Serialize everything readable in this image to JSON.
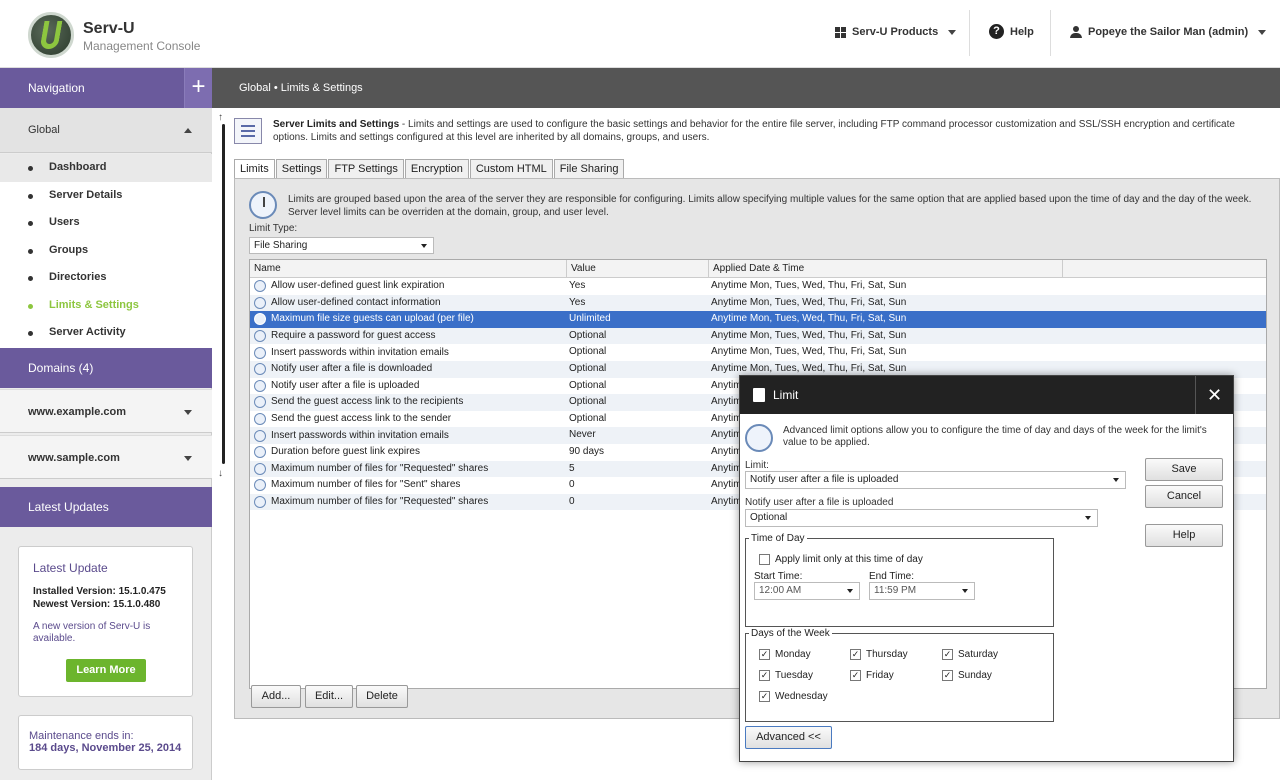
{
  "header": {
    "app_title": "Serv-U",
    "app_subtitle": "Management Console",
    "products_label": "Serv-U Products",
    "help_label": "Help",
    "user_label": "Popeye the Sailor Man (admin)"
  },
  "sidebar": {
    "navigation_label": "Navigation",
    "plus_label": "+",
    "global_label": "Global",
    "nav_items": [
      {
        "label": "Dashboard"
      },
      {
        "label": "Server Details"
      },
      {
        "label": "Users"
      },
      {
        "label": "Groups"
      },
      {
        "label": "Directories"
      },
      {
        "label": "Limits & Settings"
      },
      {
        "label": "Server Activity"
      }
    ],
    "domains_label": "Domains (4)",
    "domains": [
      "www.example.com",
      "www.sample.com"
    ],
    "latest_updates_label": "Latest Updates",
    "update_card": {
      "title": "Latest Update",
      "installed": "Installed Version: 15.1.0.475",
      "newest": "Newest Version: 15.1.0.480",
      "message": "A new version of Serv-U is available.",
      "learn_more": "Learn More"
    },
    "maintenance": {
      "line1": "Maintenance ends in:",
      "line2": "184 days, November 25, 2014"
    }
  },
  "breadcrumb": "Global • Limits & Settings",
  "main": {
    "desc_title": "Server Limits and Settings",
    "desc_text": " - Limits and settings are used to configure the basic settings and behavior for the entire file server, including FTP command processor customization and SSL/SSH encryption and certificate options. Limits and settings configured at this level are inherited by all domains, groups, and users.",
    "tabs": [
      "Limits",
      "Settings",
      "FTP Settings",
      "Encryption",
      "Custom HTML",
      "File Sharing"
    ],
    "info_text": "Limits are grouped based upon the area of the server they are responsible for configuring. Limits allow specifying multiple values for the same option that are applied based upon the time of day and the day of the week. Server level limits can be overriden at the domain, group, and user level.",
    "limit_type_label": "Limit Type:",
    "limit_type_value": "File Sharing",
    "columns": [
      "Name",
      "Value",
      "Applied Date & Time"
    ],
    "rows": [
      {
        "name": "Allow user-defined guest link expiration",
        "value": "Yes",
        "date": "Anytime Mon, Tues, Wed, Thu, Fri, Sat, Sun"
      },
      {
        "name": "Allow user-defined contact information",
        "value": "Yes",
        "date": "Anytime Mon, Tues, Wed, Thu, Fri, Sat, Sun"
      },
      {
        "name": "Maximum file size guests can upload (per file)",
        "value": "Unlimited",
        "date": "Anytime Mon, Tues, Wed, Thu, Fri, Sat, Sun"
      },
      {
        "name": "Require a password for guest access",
        "value": "Optional",
        "date": "Anytime Mon, Tues, Wed, Thu, Fri, Sat, Sun"
      },
      {
        "name": "Insert passwords within invitation emails",
        "value": "Optional",
        "date": "Anytime Mon, Tues, Wed, Thu, Fri, Sat, Sun"
      },
      {
        "name": "Notify user after a file is downloaded",
        "value": "Optional",
        "date": "Anytime Mon, Tues, Wed, Thu, Fri, Sat, Sun"
      },
      {
        "name": "Notify user after a file is uploaded",
        "value": "Optional",
        "date": "Anytim"
      },
      {
        "name": "Send the guest access link to the recipients",
        "value": "Optional",
        "date": "Anytim"
      },
      {
        "name": "Send the guest access link to the sender",
        "value": "Optional",
        "date": "Anytim"
      },
      {
        "name": "Insert passwords within invitation emails",
        "value": "Never",
        "date": "Anytim"
      },
      {
        "name": "Duration before guest link expires",
        "value": "90 days",
        "date": "Anytim"
      },
      {
        "name": "Maximum number of files for \"Requested\" shares",
        "value": "5",
        "date": "Anytim"
      },
      {
        "name": "Maximum number of files for \"Sent\" shares",
        "value": "0",
        "date": "Anytim"
      },
      {
        "name": "Maximum number of files for \"Requested\" shares",
        "value": "0",
        "date": "Anytim"
      }
    ],
    "buttons": {
      "add": "Add...",
      "edit": "Edit...",
      "delete": "Delete"
    }
  },
  "dialog": {
    "title": "Limit",
    "close": "✕",
    "info": "Advanced limit options allow you to configure the time of day and days of the week for the limit's value to be applied.",
    "limit_label": "Limit:",
    "limit_value": "Notify user after a file is uploaded",
    "option_label": "Notify user after a file is uploaded",
    "option_value": "Optional",
    "save": "Save",
    "cancel": "Cancel",
    "help": "Help",
    "time_of_day": "Time of Day",
    "apply_time": "Apply limit only at this time of day",
    "start_label": "Start Time:",
    "start_value": "12:00 AM",
    "end_label": "End Time:",
    "end_value": "11:59 PM",
    "days_legend": "Days of the Week",
    "days": {
      "monday": "Monday",
      "thursday": "Thursday",
      "saturday": "Saturday",
      "tuesday": "Tuesday",
      "friday": "Friday",
      "sunday": "Sunday",
      "wednesday": "Wednesday"
    },
    "advanced": "Advanced <<"
  },
  "colors": {
    "accent_purple": "#6a5a9c",
    "active_green": "#8dc63f",
    "selection_blue": "#3a6fc8"
  }
}
